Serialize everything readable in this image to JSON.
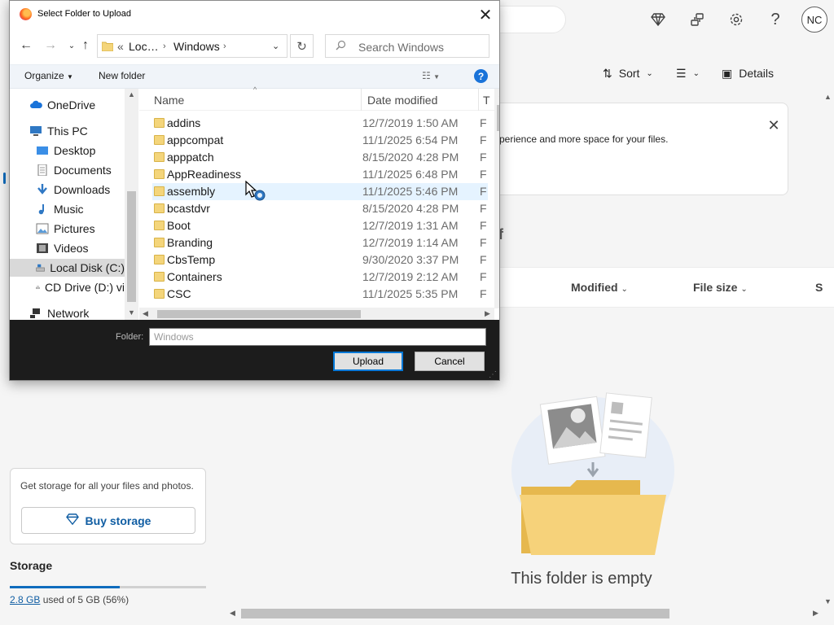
{
  "background": {
    "avatar_initials": "NC",
    "command_bar": {
      "sort_label": "Sort",
      "details_label": "Details"
    },
    "banner_text": "perience and more space for your files.",
    "partial_heading": "f",
    "columns": {
      "modified": "Modified",
      "file_size": "File size",
      "partial": "S"
    },
    "empty_state": {
      "title": "This folder is empty"
    },
    "storage": {
      "promo_text": "Get storage for all your files and photos.",
      "buy_button": "Buy storage",
      "label": "Storage",
      "used_amount": "2.8 GB",
      "used_suffix": "used of 5 GB (56%)",
      "used_percent": 56
    }
  },
  "dialog": {
    "title": "Select Folder to Upload",
    "address": {
      "prefix": "«",
      "seg1": "Loc…",
      "seg2": "Windows"
    },
    "search_placeholder": "Search Windows",
    "toolbar": {
      "organize": "Organize",
      "new_folder": "New folder"
    },
    "nav_items": [
      {
        "label": "OneDrive",
        "icon": "cloud-icon"
      },
      {
        "label": "This PC",
        "icon": "pc-icon"
      },
      {
        "label": "Desktop",
        "icon": "desktop-icon"
      },
      {
        "label": "Documents",
        "icon": "documents-icon"
      },
      {
        "label": "Downloads",
        "icon": "downloads-icon"
      },
      {
        "label": "Music",
        "icon": "music-icon"
      },
      {
        "label": "Pictures",
        "icon": "pictures-icon"
      },
      {
        "label": "Videos",
        "icon": "videos-icon"
      },
      {
        "label": "Local Disk (C:)",
        "icon": "disk-icon",
        "selected": true
      },
      {
        "label": "CD Drive (D:) vi",
        "icon": "cd-icon"
      },
      {
        "label": "Network",
        "icon": "network-icon"
      }
    ],
    "columns": {
      "name": "Name",
      "date_modified": "Date modified",
      "type": "T"
    },
    "files": [
      {
        "name": "addins",
        "date": "12/7/2019 1:50 AM",
        "type": "F"
      },
      {
        "name": "appcompat",
        "date": "11/1/2025 6:54 PM",
        "type": "F"
      },
      {
        "name": "apppatch",
        "date": "8/15/2020 4:28 PM",
        "type": "F"
      },
      {
        "name": "AppReadiness",
        "date": "11/1/2025 6:48 PM",
        "type": "F"
      },
      {
        "name": "assembly",
        "date": "11/1/2025 5:46 PM",
        "type": "F",
        "hover": true
      },
      {
        "name": "bcastdvr",
        "date": "8/15/2020 4:28 PM",
        "type": "F"
      },
      {
        "name": "Boot",
        "date": "12/7/2019 1:31 AM",
        "type": "F"
      },
      {
        "name": "Branding",
        "date": "12/7/2019 1:14 AM",
        "type": "F"
      },
      {
        "name": "CbsTemp",
        "date": "9/30/2020 3:37 PM",
        "type": "F"
      },
      {
        "name": "Containers",
        "date": "12/7/2019 2:12 AM",
        "type": "F"
      },
      {
        "name": "CSC",
        "date": "11/1/2025 5:35 PM",
        "type": "F"
      }
    ],
    "folder_label": "Folder:",
    "folder_value": "Windows",
    "upload_button": "Upload",
    "cancel_button": "Cancel"
  }
}
